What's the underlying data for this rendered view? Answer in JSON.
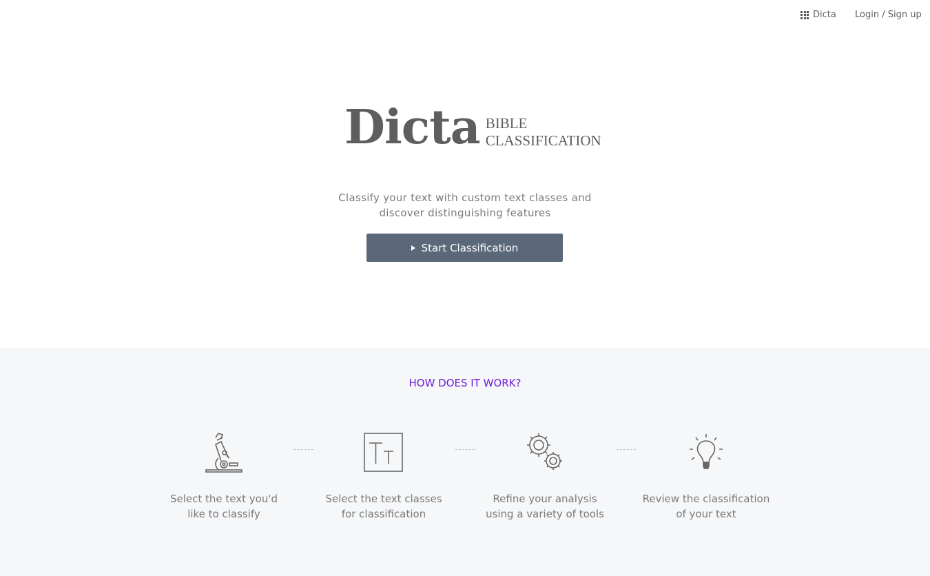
{
  "topbar": {
    "apps_label": "Dicta",
    "login_label": "Login / Sign up"
  },
  "hero": {
    "logo_main": "Dicta",
    "logo_sub_line1": "BIBLE",
    "logo_sub_line2": "CLASSIFICATION",
    "tagline_line1": "Classify your text with custom text classes and",
    "tagline_line2": "discover distinguishing features",
    "start_button_label": "Start Classification"
  },
  "how": {
    "title": "HOW DOES IT WORK?",
    "steps": [
      {
        "icon": "microscope-icon",
        "line1": "Select the text you'd",
        "line2": "like to classify"
      },
      {
        "icon": "text-size-icon",
        "line1": "Select the text classes",
        "line2": "for classification"
      },
      {
        "icon": "gears-icon",
        "line1": "Refine your analysis",
        "line2": "using a variety of tools"
      },
      {
        "icon": "lightbulb-icon",
        "line1": "Review the classification",
        "line2": "of your text"
      }
    ]
  },
  "colors": {
    "button_bg": "#5a687a",
    "accent_title": "#6a1fd6",
    "section_bg": "#f6f7f9"
  }
}
